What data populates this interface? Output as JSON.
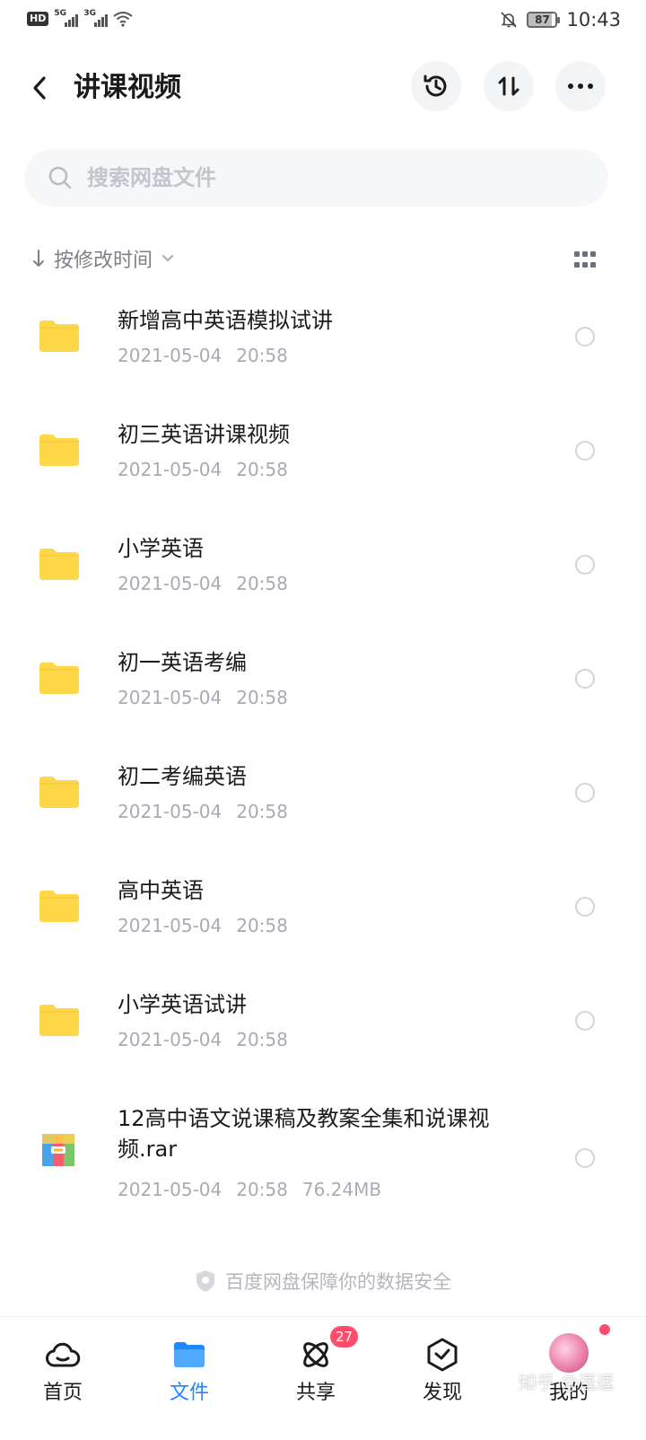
{
  "status_bar": {
    "hd": "HD",
    "sim1_network": "5G",
    "sim2_network": "3G",
    "battery": "87",
    "time": "10:43"
  },
  "header": {
    "title": "讲课视频",
    "icons": [
      "back-arrow-icon",
      "history-icon",
      "sort-icon",
      "more-icon"
    ]
  },
  "search": {
    "placeholder": "搜索网盘文件",
    "value": ""
  },
  "sort": {
    "label": "按修改时间"
  },
  "files": [
    {
      "name": "新增高中英语模拟试讲",
      "date": "2021-05-04",
      "time": "20:58",
      "size": "",
      "type": "folder"
    },
    {
      "name": "初三英语讲课视频",
      "date": "2021-05-04",
      "time": "20:58",
      "size": "",
      "type": "folder"
    },
    {
      "name": "小学英语",
      "date": "2021-05-04",
      "time": "20:58",
      "size": "",
      "type": "folder"
    },
    {
      "name": "初一英语考编",
      "date": "2021-05-04",
      "time": "20:58",
      "size": "",
      "type": "folder"
    },
    {
      "name": "初二考编英语",
      "date": "2021-05-04",
      "time": "20:58",
      "size": "",
      "type": "folder"
    },
    {
      "name": "高中英语",
      "date": "2021-05-04",
      "time": "20:58",
      "size": "",
      "type": "folder"
    },
    {
      "name": "小学英语试讲",
      "date": "2021-05-04",
      "time": "20:58",
      "size": "",
      "type": "folder"
    },
    {
      "name": "12高中语文说课稿及教案全集和说课视频.rar",
      "date": "2021-05-04",
      "time": "20:58",
      "size": "76.24MB",
      "type": "rar"
    }
  ],
  "security_note": "百度网盘保障你的数据安全",
  "nav": {
    "items": [
      {
        "label": "首页",
        "icon": "cloud-icon"
      },
      {
        "label": "文件",
        "icon": "folder-icon",
        "active": true
      },
      {
        "label": "共享",
        "icon": "share-orbit-icon",
        "badge": "27"
      },
      {
        "label": "发现",
        "icon": "discover-icon"
      },
      {
        "label": "我的",
        "icon": "avatar"
      }
    ]
  },
  "watermark": "知乎 @逗逗",
  "colors": {
    "accent": "#1e88ff",
    "folder": "#ffd84a",
    "badge": "#ff4d6d"
  }
}
